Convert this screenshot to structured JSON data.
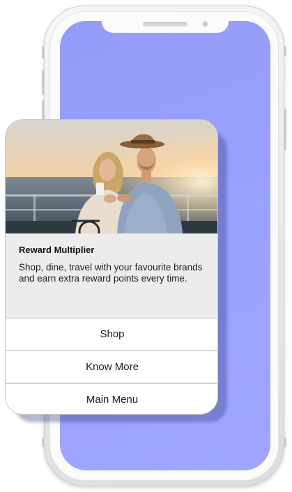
{
  "card": {
    "title": "Reward Multiplier",
    "description": "Shop, dine, travel with your favourite brands and earn extra reward points every time.",
    "image_alt": "couple-looking-at-phone-at-sunset"
  },
  "actions": [
    {
      "label": "Shop"
    },
    {
      "label": "Know More"
    },
    {
      "label": "Main Menu"
    }
  ],
  "colors": {
    "screen": "#9aa2ff",
    "card_body": "#ececec",
    "button_bg": "#ffffff"
  }
}
